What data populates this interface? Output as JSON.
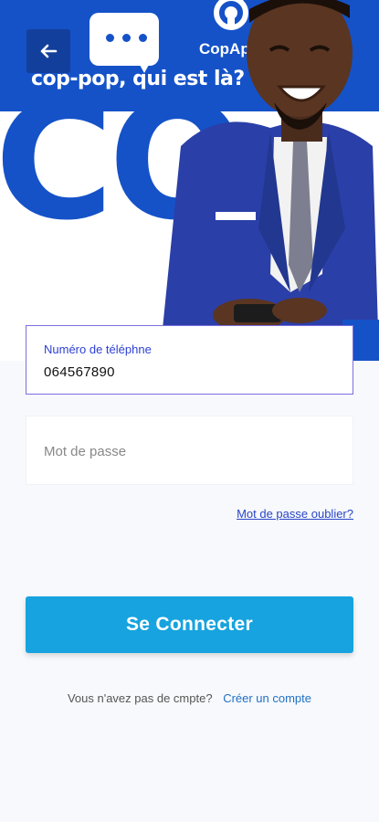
{
  "hero": {
    "tagline": "cop-pop, qui est là?",
    "brand": "CopApp",
    "big_letters": "CO",
    "colors": {
      "primary": "#1552c8",
      "accent": "#17a3df"
    }
  },
  "nav": {
    "back_icon": "arrow-left-icon"
  },
  "form": {
    "phone": {
      "label": "Numéro de téléphne",
      "value": "064567890"
    },
    "password": {
      "placeholder": "Mot de passe"
    },
    "forgot_link": "Mot de passe oublier?",
    "submit_label": "Se Connecter"
  },
  "footer": {
    "prompt": "Vous n'avez pas de cmpte?",
    "signup_link": "Créer un compte"
  }
}
